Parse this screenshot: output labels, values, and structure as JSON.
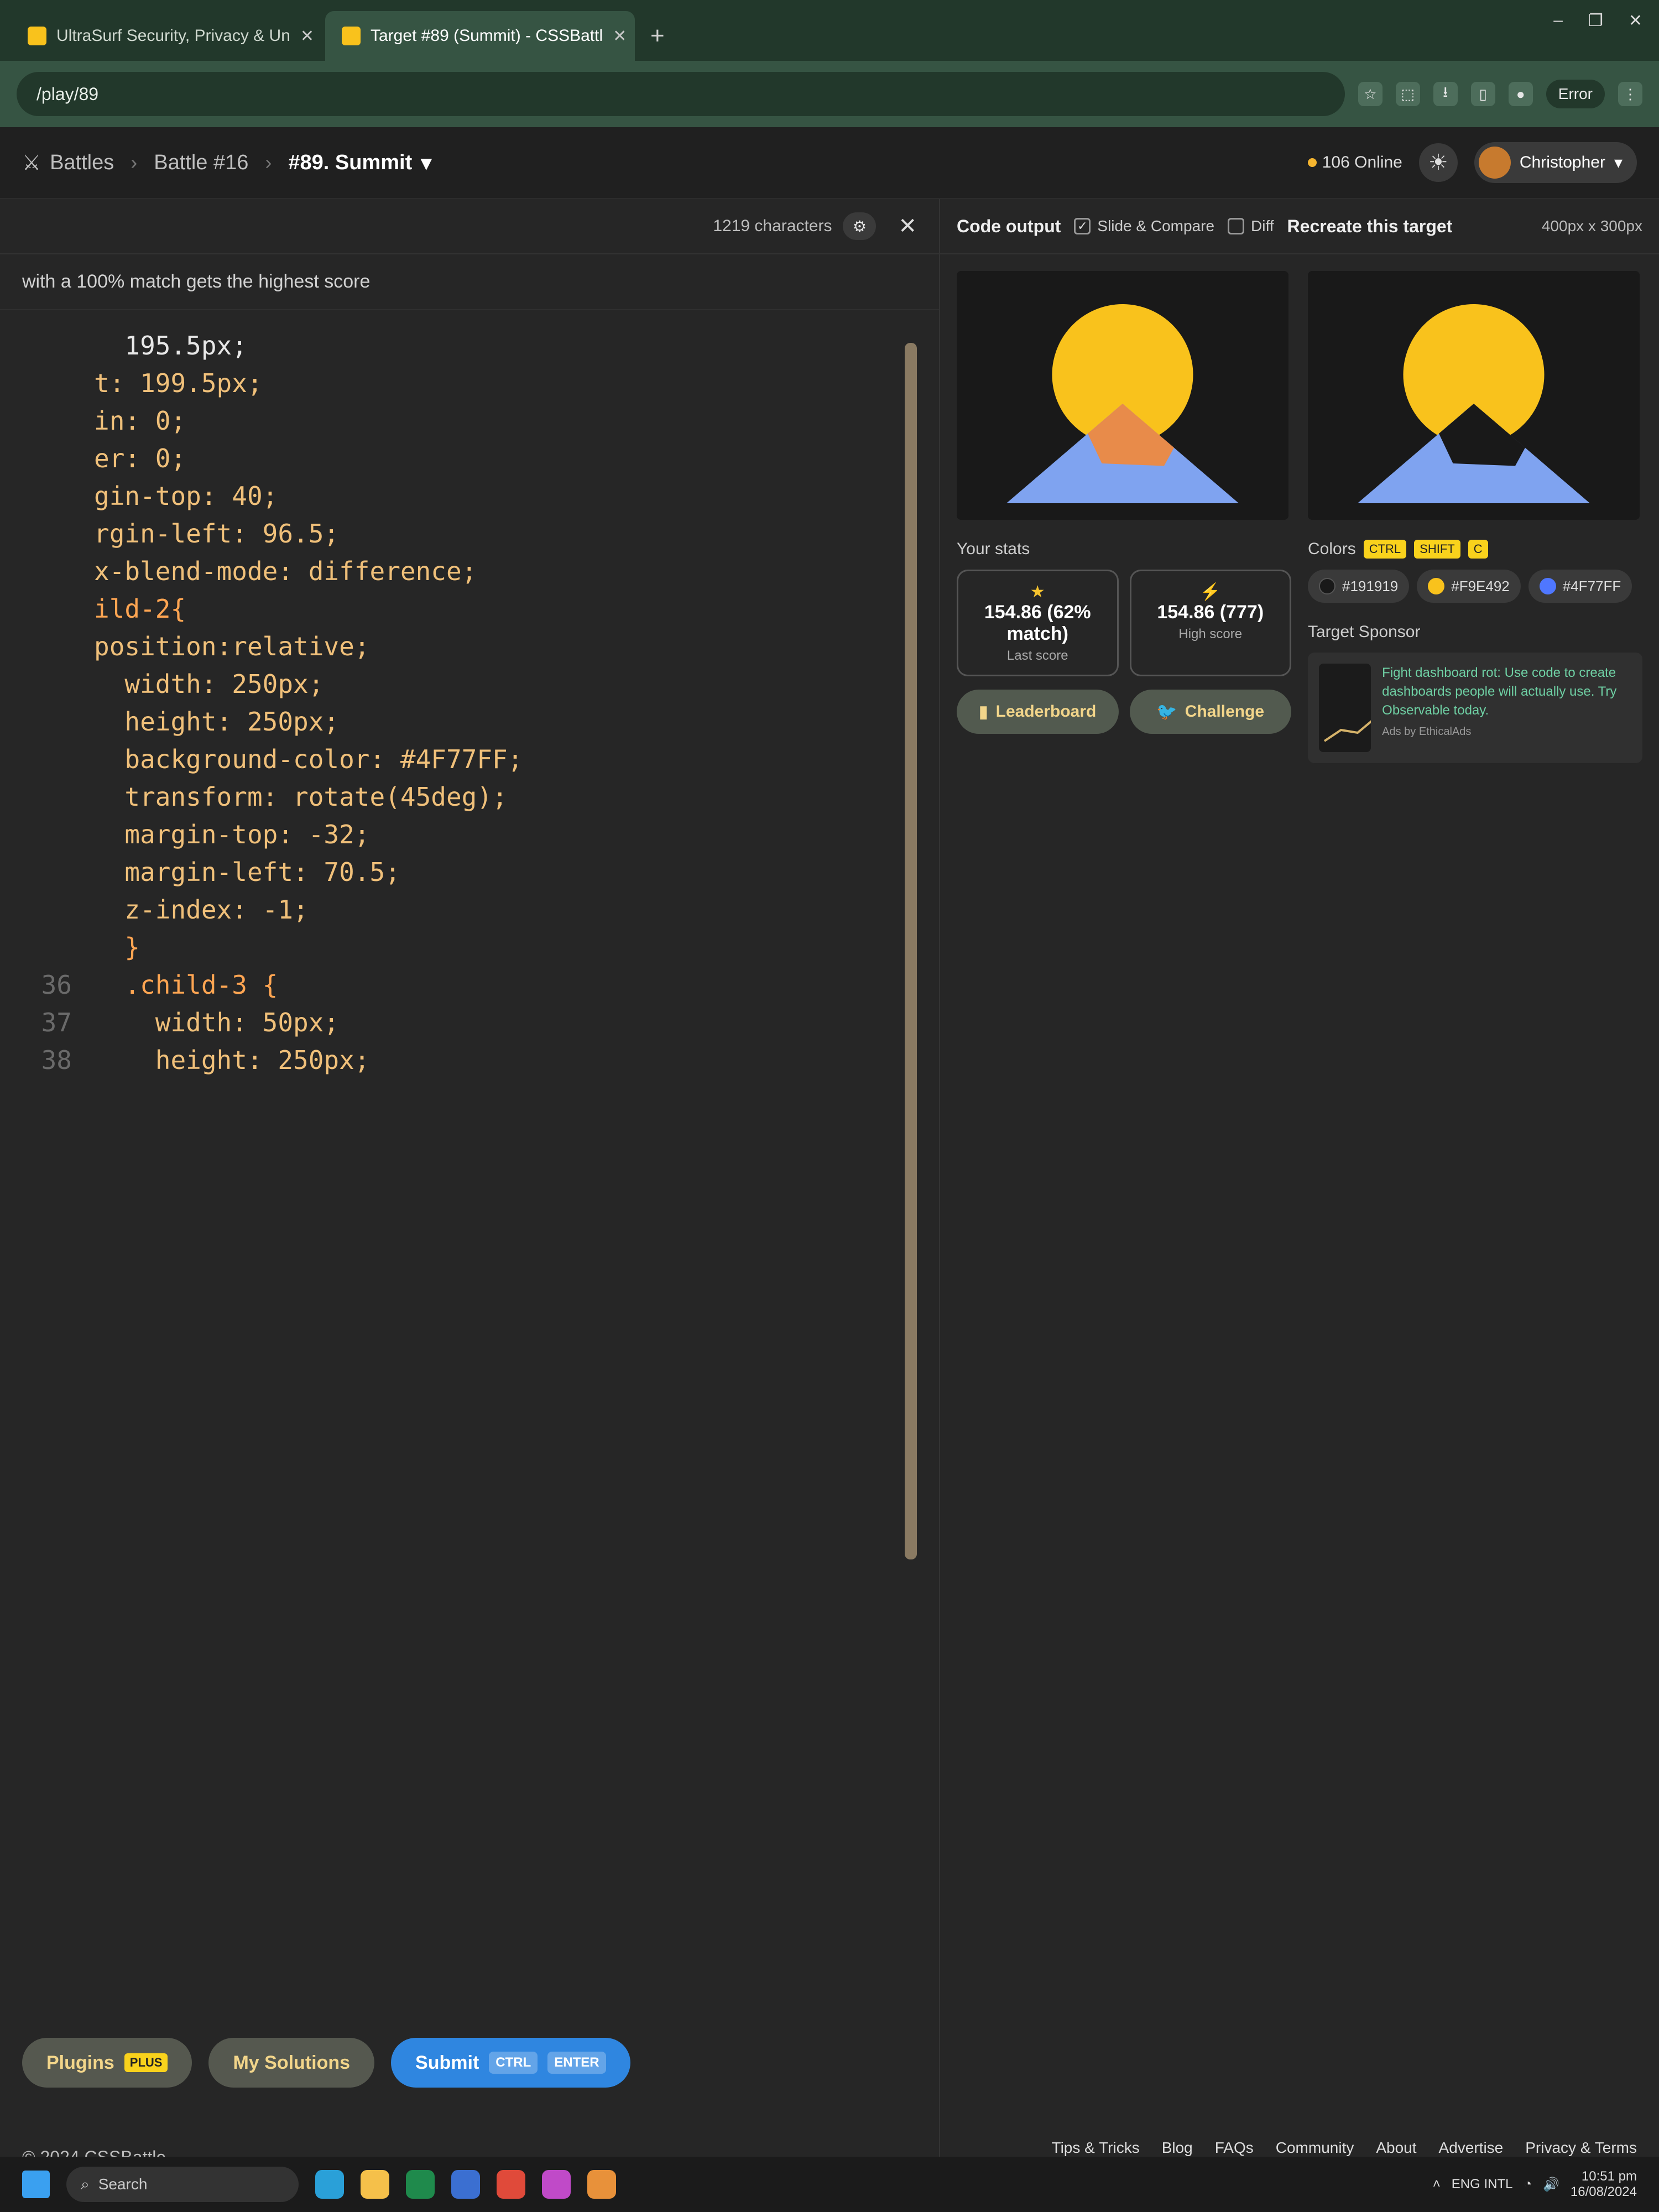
{
  "browser": {
    "tabs": [
      {
        "title": "UltraSurf Security, Privacy & Un",
        "active": false
      },
      {
        "title": "Target #89 (Summit) - CSSBattl",
        "active": true
      }
    ],
    "new_tab": "+",
    "url": "/play/89",
    "error_label": "Error"
  },
  "topbar": {
    "crumbs": [
      "Battles",
      "Battle #16",
      "#89. Summit"
    ],
    "online": "106 Online",
    "user": "Christopher"
  },
  "editor": {
    "chars": "1219 characters",
    "hint": "with a 100% match gets the highest score",
    "lines": [
      {
        "n": "",
        "code": "  195.5px;"
      },
      {
        "n": "",
        "code": "t: 199.5px;"
      },
      {
        "n": "",
        "code": "in: 0;"
      },
      {
        "n": "",
        "code": "er: 0;"
      },
      {
        "n": "",
        "code": "gin-top: 40;"
      },
      {
        "n": "",
        "code": "rgin-left: 96.5;"
      },
      {
        "n": "",
        "code": "x-blend-mode: difference;"
      },
      {
        "n": "",
        "code": ""
      },
      {
        "n": "",
        "code": ""
      },
      {
        "n": "",
        "code": "ild-2{"
      },
      {
        "n": "",
        "code": "position:relative;"
      },
      {
        "n": "",
        "code": "  width: 250px;"
      },
      {
        "n": "",
        "code": "  height: 250px;"
      },
      {
        "n": "",
        "code": "  background-color: #4F77FF;"
      },
      {
        "n": "",
        "code": "  transform: rotate(45deg);"
      },
      {
        "n": "",
        "code": "  margin-top: -32;"
      },
      {
        "n": "",
        "code": "  margin-left: 70.5;"
      },
      {
        "n": "",
        "code": "  z-index: -1;"
      },
      {
        "n": "",
        "code": ""
      },
      {
        "n": "",
        "code": "  }"
      },
      {
        "n": "36",
        "code": "  .child-3 {"
      },
      {
        "n": "37",
        "code": "    width: 50px;"
      },
      {
        "n": "38",
        "code": "    height: 250px;"
      }
    ],
    "submit": "Submit",
    "kbd_ctrl": "CTRL",
    "kbd_enter": "ENTER",
    "my_solutions": "My Solutions",
    "plugins": "Plugins",
    "plus": "PLUS",
    "copyright": "© 2024 CSSBattle"
  },
  "right": {
    "code_output": "Code output",
    "slide_compare": "Slide & Compare",
    "diff": "Diff",
    "recreate": "Recreate this target",
    "size": "400px x 300px",
    "your_stats": "Your stats",
    "last_score": "154.86 (62% match)",
    "last_label": "Last score",
    "high_score": "154.86 (777)",
    "high_label": "High score",
    "leaderboard": "Leaderboard",
    "challenge": "Challenge",
    "colors_label": "Colors",
    "ctrl": "CTRL",
    "shift": "SHIFT",
    "c": "C",
    "colors": [
      "#191919",
      "#F9E492",
      "#4F77FF"
    ],
    "swatch_colors": [
      "#191919",
      "#F9C21C",
      "#4F77FF"
    ],
    "sponsor_label": "Target Sponsor",
    "sponsor_text": "Fight dashboard rot: Use code to create dashboards people will actually use. Try Observable today.",
    "ads_by": "Ads by EthicalAds"
  },
  "footer": {
    "links": [
      "Tips & Tricks",
      "Blog",
      "FAQs",
      "Community",
      "About",
      "Advertise",
      "Privacy & Terms"
    ]
  },
  "taskbar": {
    "search": "Search",
    "lang": "ENG INTL",
    "time": "10:51 pm",
    "date": "16/08/2024"
  }
}
